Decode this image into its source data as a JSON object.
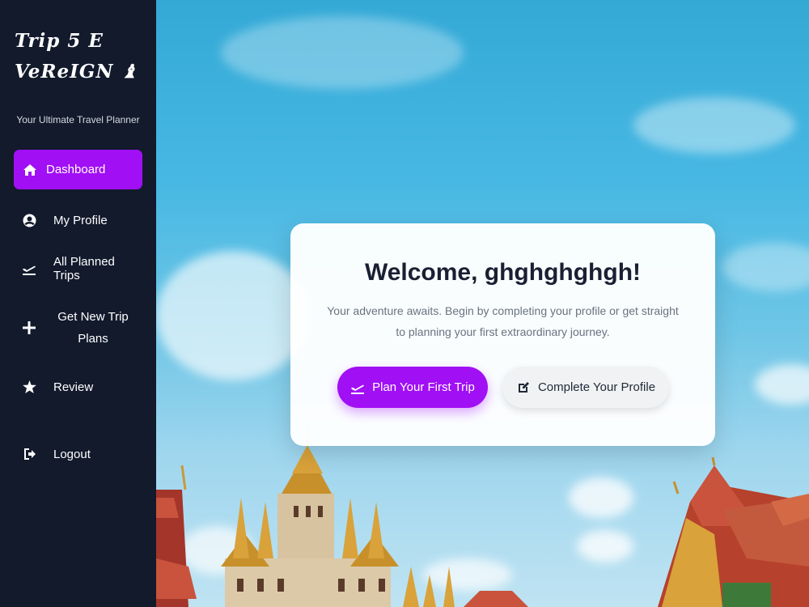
{
  "sidebar": {
    "brand_line1": "Trip 5 E",
    "brand_line2": "VeReIGN ♝",
    "tagline": "Your Ultimate Travel Planner",
    "items": [
      {
        "label": "Dashboard",
        "icon": "home-icon",
        "active": true
      },
      {
        "label": "My Profile",
        "icon": "user-circle-icon"
      },
      {
        "label": "All Planned Trips",
        "icon": "plane-departure-icon"
      },
      {
        "label": "Get New Trip Plans",
        "icon": "plus-icon"
      },
      {
        "label": "Review",
        "icon": "star-icon"
      },
      {
        "label": "Logout",
        "icon": "logout-icon"
      }
    ]
  },
  "welcome": {
    "title": "Welcome, ghghghghgh!",
    "message": "Your adventure awaits. Begin by completing your profile or get straight to planning your first extraordinary journey.",
    "primary_button": "Plan Your First Trip",
    "secondary_button": "Complete Your Profile"
  },
  "colors": {
    "accent": "#a10ff5",
    "sidebar_bg": "#121a2c"
  }
}
